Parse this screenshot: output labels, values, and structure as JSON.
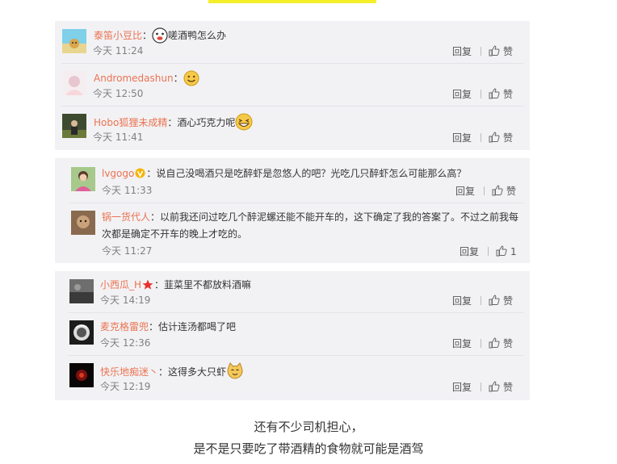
{
  "ui": {
    "reply_label": "回复",
    "like_label": "赞"
  },
  "panels": [
    {
      "comments": [
        {
          "user": "泰笛小豆比",
          "text": "嗟酒鸭怎么办",
          "time": "今天 11:24"
        },
        {
          "user": "Andromedashun",
          "text": "",
          "time": "今天 12:50"
        },
        {
          "user": "Hobo狐狸未成精",
          "text": "酒心巧克力呢",
          "time": "今天 11:41"
        }
      ]
    },
    {
      "comments": [
        {
          "user": "lvgogo",
          "text": "说自己没喝酒只是吃醉虾是忽悠人的吧？光吃几只醉虾怎么可能那么高？",
          "time": "今天 11:33"
        },
        {
          "user": "锅一货代人",
          "text_line1": "以前我还问过吃几个醉泥螺还能不能开车的，这下确定了我的答案了。不过之前我每",
          "text_line2": "次都是确定不开车的晚上才吃的。",
          "time": "今天 11:27",
          "likes": "1"
        }
      ]
    },
    {
      "comments": [
        {
          "user": "小西瓜_H",
          "text": "韮菜里不都放料酒嘛",
          "time": "今天 14:19"
        },
        {
          "user": "麦克格雷兜",
          "text": "估计连汤都喝了吧",
          "time": "今天 12:36"
        },
        {
          "user": "快乐地痴迷丶",
          "text": "这得多大只虾",
          "time": "今天 12:19"
        }
      ]
    }
  ],
  "caption": {
    "line1": "还有不少司机担心，",
    "line2": "是不是只要吃了带酒精的食物就可能是酒驾"
  },
  "colors": {
    "username": "#eb7350",
    "panel_bg": "#f2f2f5",
    "highlight": "#f5ef2a"
  }
}
